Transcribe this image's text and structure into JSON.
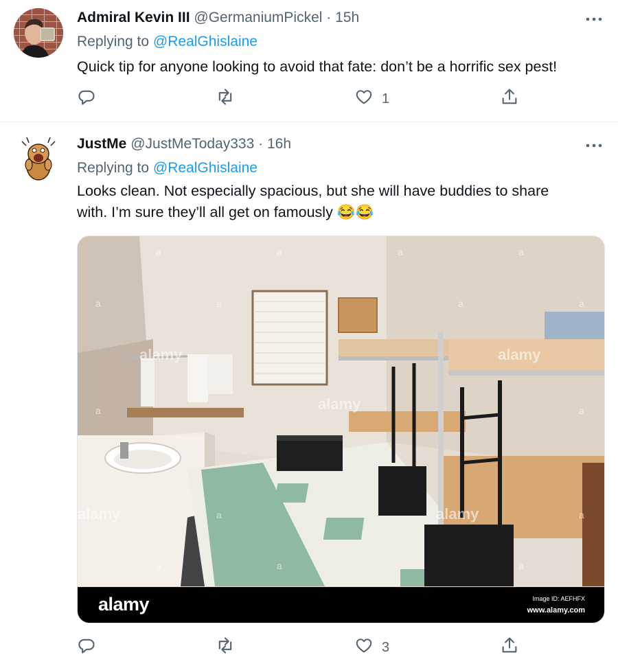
{
  "tweets": [
    {
      "display_name": "Admiral Kevin III",
      "handle": "@GermaniumPickel",
      "time": "· 15h",
      "replying_prefix": "Replying to",
      "replying_to": "@RealGhislaine",
      "text": "Quick tip for anyone looking to avoid that fate: don’t be a horrific sex pest!",
      "likes": "1",
      "icons": [
        "reply-icon",
        "retweet-icon",
        "like-icon",
        "share-icon",
        "more-icon"
      ]
    },
    {
      "display_name": "JustMe",
      "handle": "@JustMeToday333",
      "time": "· 16h",
      "replying_prefix": "Replying to",
      "replying_to": "@RealGhislaine",
      "text": "Looks clean. Not especially spacious, but she will have buddies to share with. I’m sure they’ll all get on famously 😂😂",
      "likes": "3",
      "media": {
        "watermark": "alamy",
        "watermark_letter": "a",
        "bar_logo": "alamy",
        "image_id": "Image ID: AEFHFX",
        "url": "www.alamy.com"
      }
    }
  ],
  "colors": {
    "text": "#0f1419",
    "secondary": "#536471",
    "link": "#1d9bf0",
    "divider": "#eff3f4"
  }
}
